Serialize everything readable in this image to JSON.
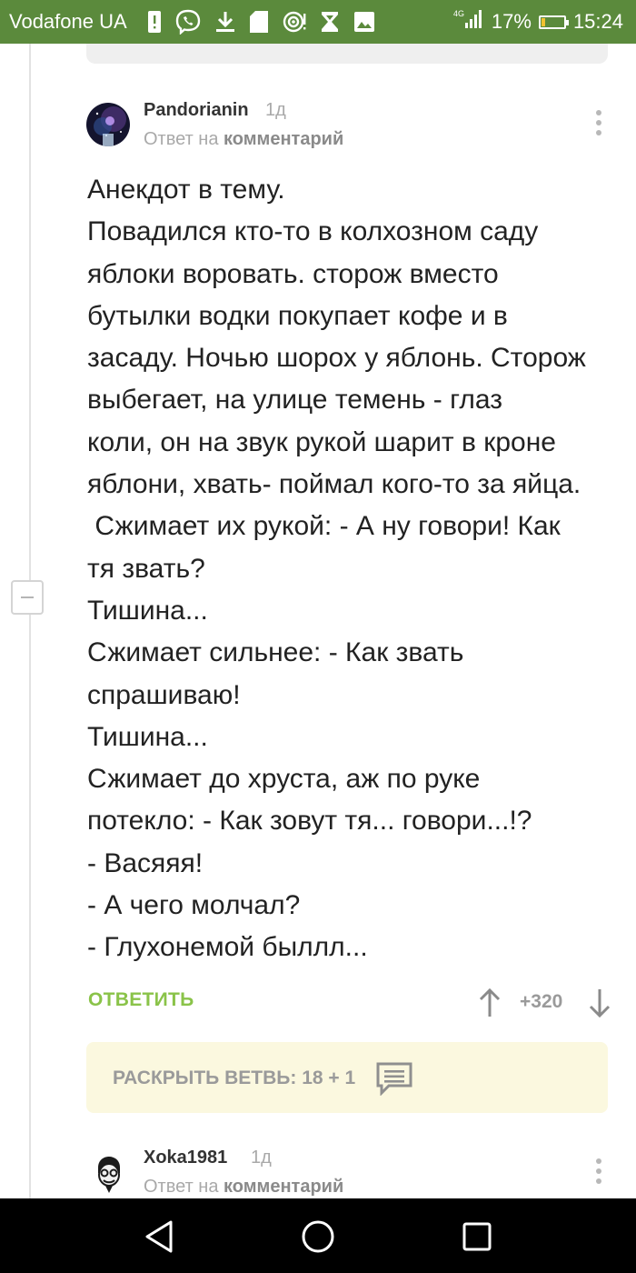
{
  "status_bar": {
    "carrier": "Vodafone UA",
    "network": "4G",
    "battery_percent": "17%",
    "battery_level": 0.17,
    "time": "15:24",
    "icons": [
      "sim-alert-icon",
      "viber-icon",
      "download-icon",
      "sd-card-icon",
      "wifi-hotspot-icon",
      "hourglass-icon",
      "image-icon",
      "signal-icon",
      "battery-icon"
    ]
  },
  "comments": [
    {
      "author": "Pandorianin",
      "time": "1д",
      "reply_prefix": "Ответ на",
      "reply_target": "комментарий",
      "body_lines": [
        "Анекдот в тему.",
        "Повадился кто-то в колхозном саду",
        "яблоки воровать. сторож вместо",
        "бутылки водки покупает кофе и в",
        "засаду. Ночью шорох у яблонь. Сторож",
        "выбегает, на улице темень - глаз",
        "коли, он на звук рукой шарит в кроне",
        "яблони, хвать- поймал кого-то за яйца.",
        " Сжимает их рукой: - А ну говори! Как",
        "тя звать?",
        "Тишина...",
        "Сжимает сильнее: - Как звать",
        "спрашиваю!",
        "Тишина...",
        "Сжимает до хруста, аж по руке",
        "потекло: - Как зовут тя... говори...!?",
        "- Васяяя!",
        "- А чего молчал?",
        "- Глухонемой быллл..."
      ],
      "reply_label": "ОТВЕТИТЬ",
      "rating": "+320",
      "expand_label": "РАСКРЫТЬ ВЕТВЬ: 18 + 1"
    },
    {
      "author": "Xoka1981",
      "time": "1д",
      "reply_prefix": "Ответ на",
      "reply_target": "комментарий"
    }
  ],
  "colors": {
    "status_bar": "#5b8a3c",
    "reply_green": "#8ac349",
    "expand_bg": "#fbf8df",
    "muted_text": "#a9a9a9"
  }
}
